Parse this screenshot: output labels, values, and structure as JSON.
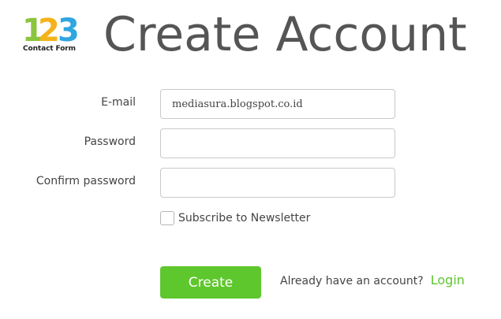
{
  "logo": {
    "digits": [
      "1",
      "2",
      "3"
    ],
    "caption": "Contact Form",
    "colors": {
      "one": "#8bc53f",
      "two": "#f6b21a",
      "three": "#2fa6df"
    }
  },
  "title": "Create Account",
  "form": {
    "email": {
      "label": "E-mail",
      "value": "mediasura.blogspot.co.id"
    },
    "password": {
      "label": "Password",
      "value": ""
    },
    "confirm_password": {
      "label": "Confirm password",
      "value": ""
    },
    "newsletter": {
      "label": "Subscribe to Newsletter",
      "checked": false
    },
    "submit_label": "Create"
  },
  "login": {
    "prompt": "Already have an account?",
    "link_label": "Login"
  },
  "colors": {
    "accent": "#5ec72d",
    "title": "#555555",
    "border": "#c9c9c9"
  }
}
